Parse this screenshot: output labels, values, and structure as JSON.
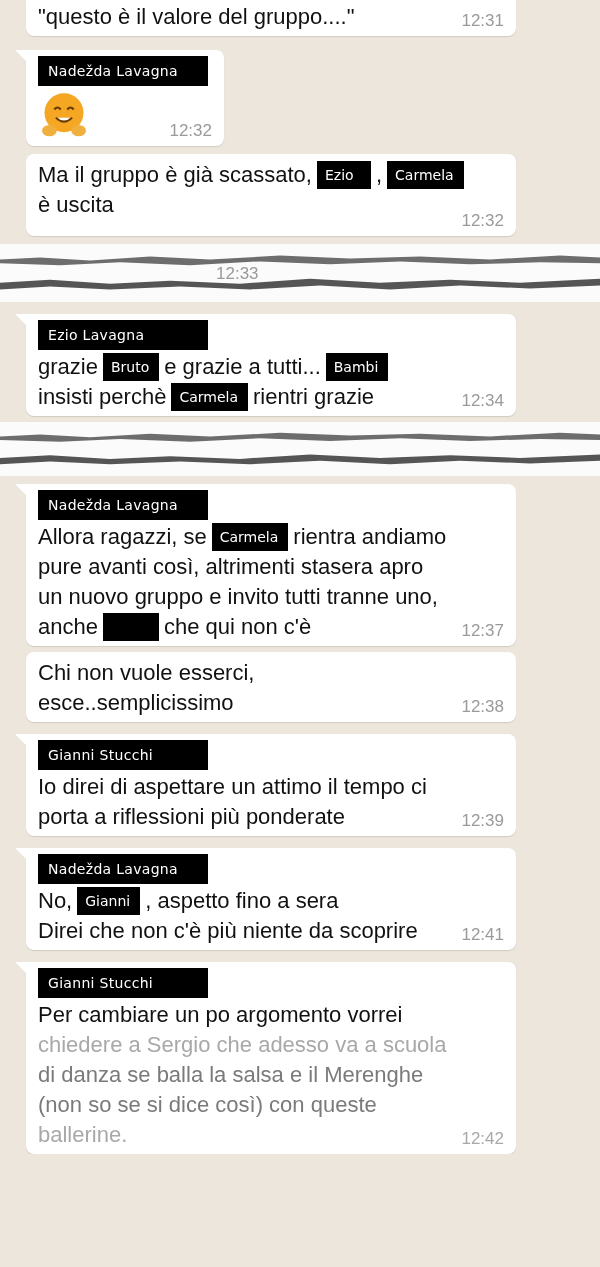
{
  "sections": [
    {
      "kind": "chat",
      "messages": [
        {
          "lines": [
            [
              {
                "kind": "text",
                "text": "\"questo è il valore del gruppo....\""
              }
            ]
          ],
          "time": "12:31"
        },
        {
          "sender": "Nadežda Lavagna",
          "kind": "emoji",
          "time": "12:32"
        },
        {
          "lines": [
            [
              {
                "kind": "text",
                "text": "Ma il gruppo è già scassato,"
              },
              {
                "kind": "tag",
                "text": "Ezio"
              },
              {
                "kind": "text",
                "text": ","
              },
              {
                "kind": "tag",
                "text": "Carmela"
              }
            ],
            [
              {
                "kind": "text",
                "text": "è uscita"
              }
            ]
          ],
          "time": "12:32"
        }
      ]
    },
    {
      "kind": "torn",
      "time": "12:33"
    },
    {
      "kind": "chat",
      "messages": [
        {
          "sender": "Ezio Lavagna",
          "lines": [
            [
              {
                "kind": "text",
                "text": "grazie"
              },
              {
                "kind": "tag",
                "text": "Bruto"
              },
              {
                "kind": "text",
                "text": "e grazie a tutti..."
              },
              {
                "kind": "tag",
                "text": "Bambi"
              }
            ],
            [
              {
                "kind": "text",
                "text": "insisti perchè"
              },
              {
                "kind": "tag",
                "text": "Carmela"
              },
              {
                "kind": "text",
                "text": "rientri grazie"
              }
            ]
          ],
          "time": "12:34"
        }
      ]
    },
    {
      "kind": "torn"
    },
    {
      "kind": "chat",
      "messages": [
        {
          "sender": "Nadežda Lavagna",
          "lines": [
            [
              {
                "kind": "text",
                "text": "Allora ragazzi, se"
              },
              {
                "kind": "tag",
                "text": "Carmela"
              },
              {
                "kind": "text",
                "text": "rientra andiamo"
              }
            ],
            [
              {
                "kind": "text",
                "text": "pure avanti così, altrimenti stasera apro"
              }
            ],
            [
              {
                "kind": "text",
                "text": "un nuovo gruppo e invito tutti tranne uno,"
              }
            ],
            [
              {
                "kind": "text",
                "text": "anche"
              },
              {
                "kind": "blank"
              },
              {
                "kind": "text",
                "text": "che qui non c'è"
              }
            ]
          ],
          "time": "12:37"
        },
        {
          "lines": [
            [
              {
                "kind": "text",
                "text": "Chi non vuole esserci,"
              }
            ],
            [
              {
                "kind": "text",
                "text": "esce..semplicissimo"
              }
            ]
          ],
          "time": "12:38"
        },
        {
          "sender": "Gianni Stucchi",
          "lines": [
            [
              {
                "kind": "text",
                "text": "Io direi di aspettare un attimo il tempo ci"
              }
            ],
            [
              {
                "kind": "text",
                "text": "porta a riflessioni più ponderate"
              }
            ]
          ],
          "time": "12:39"
        },
        {
          "sender": "Nadežda Lavagna",
          "lines": [
            [
              {
                "kind": "text",
                "text": "No,"
              },
              {
                "kind": "tag",
                "text": "Gianni"
              },
              {
                "kind": "text",
                "text": ", aspetto fino a sera"
              }
            ],
            [
              {
                "kind": "text",
                "text": "Direi che non c'è più niente da scoprire"
              }
            ]
          ],
          "time": "12:41"
        },
        {
          "sender": "Gianni Stucchi",
          "faded": true,
          "lines": [
            [
              {
                "kind": "text",
                "text": "Per cambiare un po argomento vorrei"
              }
            ],
            [
              {
                "kind": "text",
                "text": "chiedere a Sergio che adesso va a scuola"
              }
            ],
            [
              {
                "kind": "text",
                "text": "di danza se balla la salsa e il Merenghe"
              }
            ],
            [
              {
                "kind": "text",
                "text": "(non so se si dice così) con queste"
              }
            ],
            [
              {
                "kind": "text",
                "text": "ballerine."
              }
            ]
          ],
          "time": "12:42"
        }
      ]
    }
  ]
}
